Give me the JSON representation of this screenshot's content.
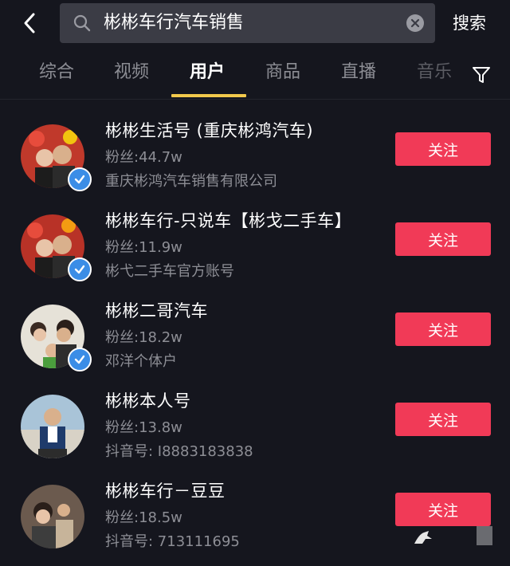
{
  "header": {
    "search_query": "彬彬车行汽车销售",
    "search_button": "搜索"
  },
  "tabs": [
    {
      "label": "综合",
      "active": false
    },
    {
      "label": "视频",
      "active": false
    },
    {
      "label": "用户",
      "active": true
    },
    {
      "label": "商品",
      "active": false
    },
    {
      "label": "直播",
      "active": false
    },
    {
      "label": "音乐",
      "active": false
    }
  ],
  "users": [
    {
      "name": "彬彬生活号 (重庆彬鸿汽车)",
      "fans": "粉丝:44.7w",
      "desc": "重庆彬鸿汽车销售有限公司",
      "verified": true,
      "follow_label": "关注"
    },
    {
      "name": "彬彬车行-只说车【彬戈二手车】",
      "fans": "粉丝:11.9w",
      "desc": "彬弋二手车官方账号",
      "verified": true,
      "follow_label": "关注"
    },
    {
      "name": "彬彬二哥汽车",
      "fans": "粉丝:18.2w",
      "desc": "邓洋个体户",
      "verified": true,
      "follow_label": "关注"
    },
    {
      "name": "彬彬本人号",
      "fans": "粉丝:13.8w",
      "desc": "抖音号: I8883183838",
      "verified": false,
      "follow_label": "关注"
    },
    {
      "name": "彬彬车行－豆豆",
      "fans": "粉丝:18.5w",
      "desc": "抖音号: 713111695",
      "verified": false,
      "follow_label": "关注"
    }
  ],
  "colors": {
    "background": "#15161e",
    "accent_follow": "#f13a57",
    "tab_indicator": "#f2c94c",
    "verified_badge": "#3b8de6"
  },
  "icons": [
    "back-chevron-icon",
    "search-icon",
    "clear-icon",
    "filter-icon",
    "verified-check-icon"
  ]
}
